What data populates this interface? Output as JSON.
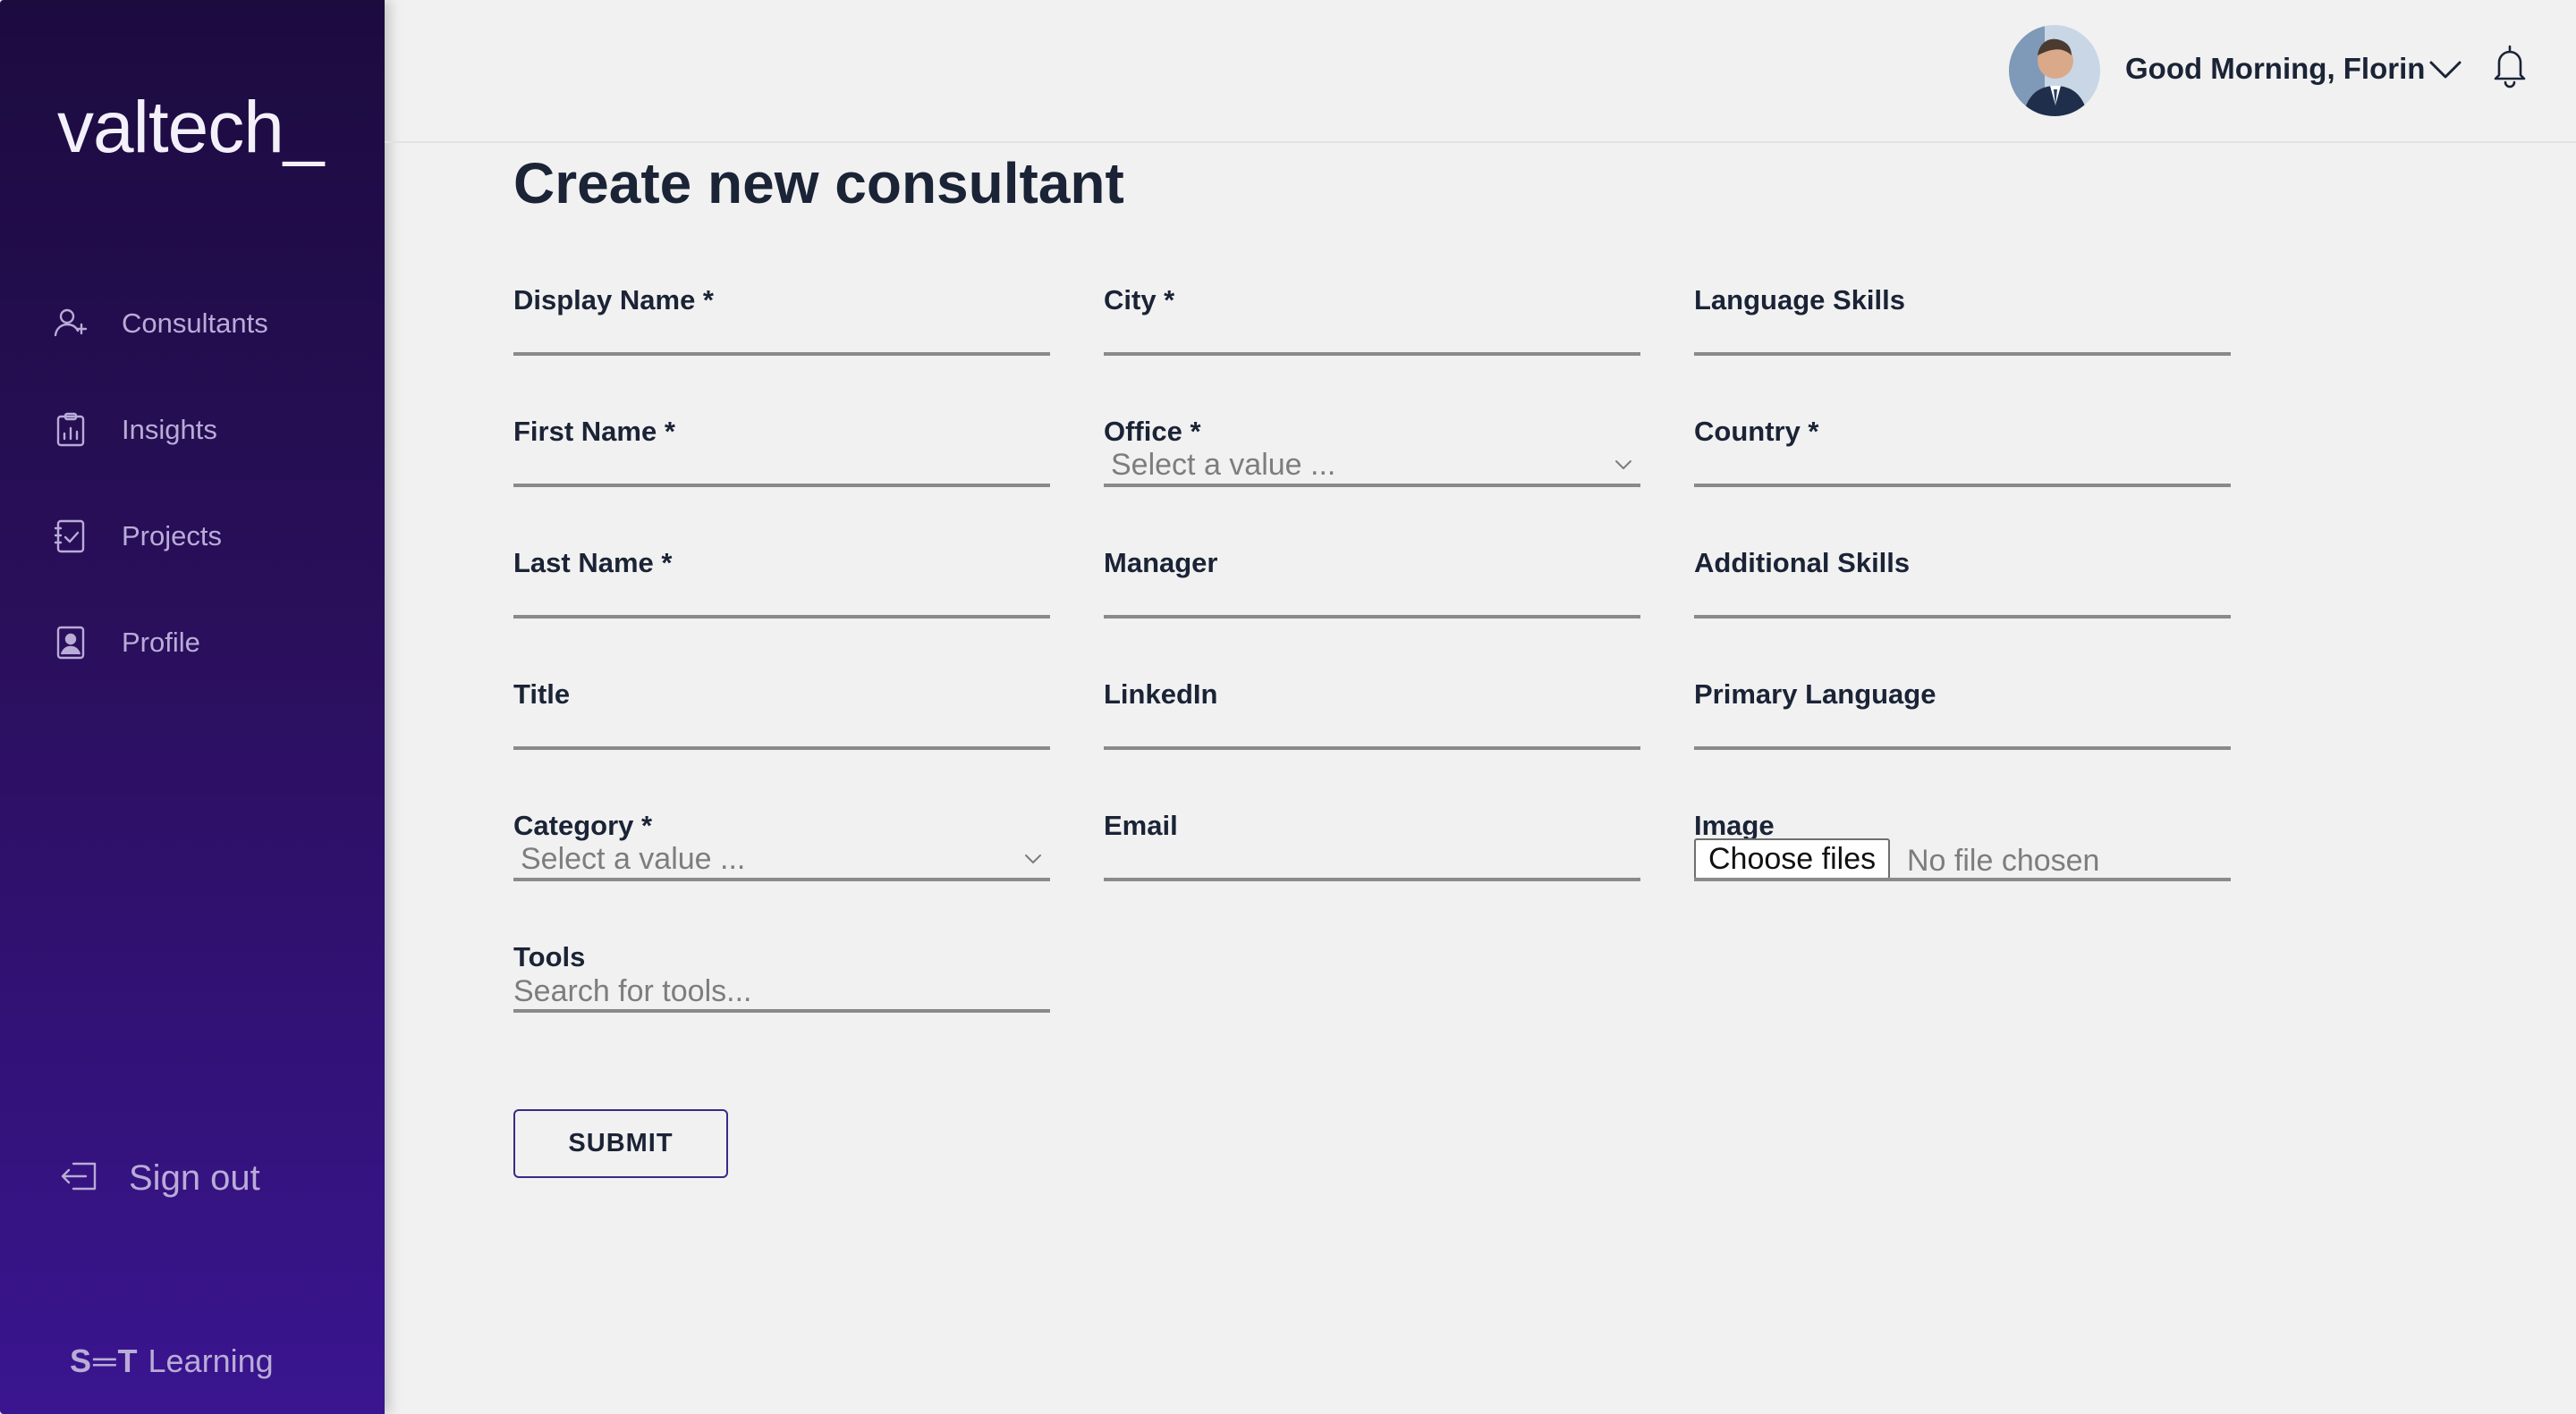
{
  "sidebar": {
    "logo": "valtech_",
    "items": [
      {
        "label": "Consultants",
        "icon": "add-person-icon"
      },
      {
        "label": "Insights",
        "icon": "clipboard-chart-icon"
      },
      {
        "label": "Projects",
        "icon": "checklist-icon"
      },
      {
        "label": "Profile",
        "icon": "person-badge-icon"
      }
    ],
    "signout": {
      "label": "Sign out",
      "icon": "sign-out-icon"
    },
    "brand": {
      "mark": "S═T",
      "word": "Learning"
    }
  },
  "header": {
    "greeting": "Good Morning, Florin",
    "icons": [
      "avatar",
      "chevron-down-icon",
      "bell-icon"
    ]
  },
  "main": {
    "title": "Create new consultant",
    "fields": {
      "display_name": {
        "label": "Display Name *",
        "value": ""
      },
      "first_name": {
        "label": "First Name *",
        "value": ""
      },
      "last_name": {
        "label": "Last Name *",
        "value": ""
      },
      "title": {
        "label": "Title",
        "value": ""
      },
      "category": {
        "label": "Category *",
        "placeholder": "Select a value ..."
      },
      "tools": {
        "label": "Tools",
        "placeholder": "Search for tools..."
      },
      "city": {
        "label": "City *",
        "value": ""
      },
      "office": {
        "label": "Office *",
        "placeholder": "Select a value ..."
      },
      "manager": {
        "label": "Manager",
        "value": ""
      },
      "linkedin": {
        "label": "LinkedIn",
        "value": ""
      },
      "email": {
        "label": "Email",
        "value": ""
      },
      "language_skills": {
        "label": "Language Skills",
        "value": ""
      },
      "country": {
        "label": "Country *",
        "value": ""
      },
      "additional_skills": {
        "label": "Additional Skills",
        "value": ""
      },
      "primary_language": {
        "label": "Primary Language",
        "value": ""
      },
      "image": {
        "label": "Image",
        "button": "Choose files",
        "status": "No file chosen"
      }
    },
    "submit_label": "SUBMIT"
  },
  "colors": {
    "sidebar_top": "#1c0b3f",
    "sidebar_bottom": "#3a1590",
    "nav_text": "#b9acd7",
    "text": "#1b2336",
    "background": "#f1f1f1",
    "submit_border": "#3a2a86"
  }
}
